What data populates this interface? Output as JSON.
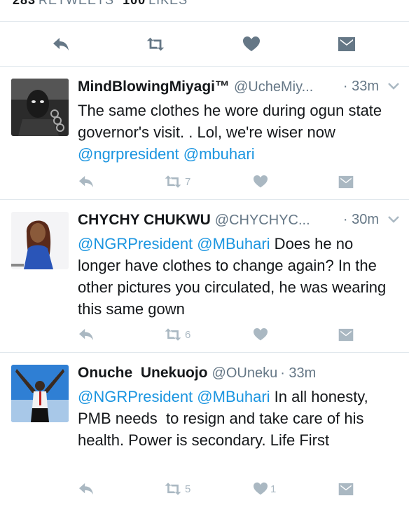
{
  "stats": {
    "retweets_count": "283",
    "retweets_label": "RETWEETS",
    "likes_count": "100",
    "likes_label": "LIKES"
  },
  "main_actions": [
    "reply-icon",
    "retweet-icon",
    "like-icon",
    "dm-icon"
  ],
  "colors": {
    "mention": "#1b95e0",
    "muted": "#657786",
    "icon": "#aab8c2",
    "main_icon": "#657786"
  },
  "tweets": [
    {
      "name": "MindBlowingMiyagi™",
      "handle": "@UcheMiy...",
      "time": "· 33m",
      "text_plain": "The same clothes he wore during ogun state governor's visit. . Lol, we're wiser now ",
      "mention1": "@ngrpresident",
      "mention2": "@mbuhari",
      "retweets": "7",
      "likes": ""
    },
    {
      "name": "CHYCHY CHUKWU",
      "handle": "@CHYCHYC...",
      "time": "· 30m",
      "mention1": "@NGRPresident",
      "mention2": "@MBuhari",
      "text_plain": " Does he no longer have clothes to change again? In the other pictures you circulated, he was wearing this same gown",
      "retweets": "6",
      "likes": ""
    },
    {
      "name": "Onuche  Unekuojo",
      "handle": "@OUneku",
      "time": "· 33m",
      "mention1": "@NGRPresident",
      "mention2": "@MBuhari",
      "text_plain": " In all honesty, PMB needs  to resign and take care of his health. Power is secondary. Life First",
      "retweets": "5",
      "likes": "1"
    }
  ]
}
